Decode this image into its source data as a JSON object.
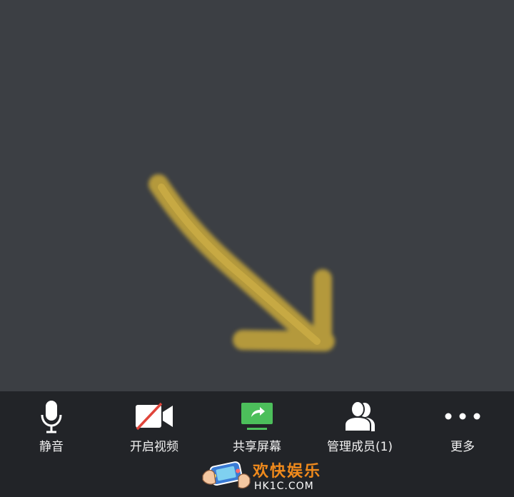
{
  "toolbar": {
    "items": [
      {
        "label": "静音",
        "icon": "microphone-icon"
      },
      {
        "label": "开启视频",
        "icon": "video-off-icon"
      },
      {
        "label": "共享屏幕",
        "icon": "share-screen-icon"
      },
      {
        "label": "管理成员(1)",
        "icon": "members-icon"
      },
      {
        "label": "更多",
        "icon": "more-icon"
      }
    ]
  },
  "watermark": {
    "title": "欢快娱乐",
    "url": "HK1C.COM"
  },
  "colors": {
    "stage_bg": "#3c3f44",
    "toolbar_bg": "#222428",
    "arrow": "#c9a93a",
    "share_accent": "#4cbf5b",
    "video_off_slash": "#e0443a",
    "watermark_title": "#f08a1c"
  }
}
